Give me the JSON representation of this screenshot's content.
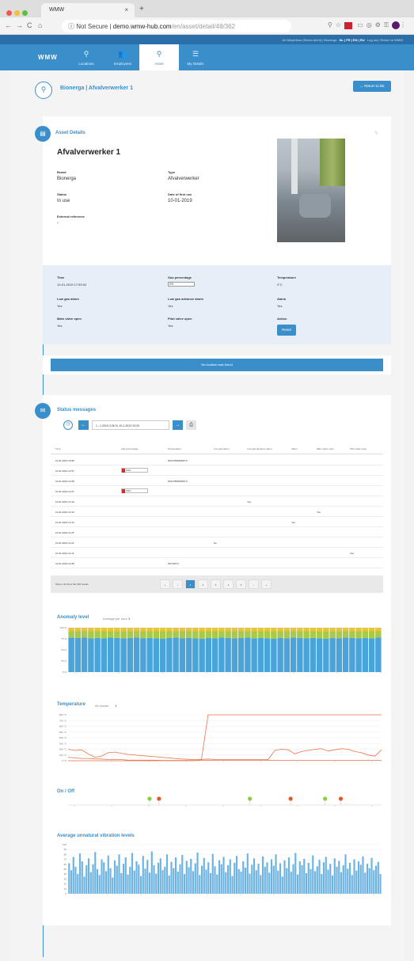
{
  "browser": {
    "tab_title": "WMW",
    "url_secure_label": "Not Secure",
    "url_host": "demo.wmw-hub.com",
    "url_path": "/en/asset/detail/48/362"
  },
  "topstrip": {
    "user": "Jef Meyenbos (Demo client)",
    "org": "Bionerga",
    "langs": "NL | FR | EN | RU",
    "links": "Log out | Return to WMW"
  },
  "nav": {
    "logo": "WMW",
    "items": [
      {
        "label": "Locations",
        "icon": "map-pin"
      },
      {
        "label": "Employees",
        "icon": "people"
      },
      {
        "label": "Asset",
        "icon": "asset-pin"
      },
      {
        "label": "My Details",
        "icon": "menu-lines"
      }
    ]
  },
  "asset_header": {
    "title": "Bionerga | Afvalverwerker 1",
    "return_button": "← Return to list"
  },
  "details": {
    "section_title": "Asset Details",
    "name": "Afvalverwerker 1",
    "fields": [
      {
        "label": "Brand",
        "value": "Bionerga"
      },
      {
        "label": "Type",
        "value": "Afvalverwerker"
      },
      {
        "label": "Status",
        "value": "In use"
      },
      {
        "label": "Date of first use",
        "value": "10-01-2019"
      },
      {
        "label": "External reference",
        "value": "-"
      }
    ]
  },
  "sensors": {
    "time_label": "Time",
    "time_value": "10-01-2019 17:53:04",
    "gas_label": "Gas percentage",
    "gas_value": "0%",
    "temp_label": "Temperature",
    "temp_value": "0°C",
    "low_gas_label": "Low gas alarm",
    "low_gas_value": "Yes",
    "low_gas_adv_label": "Low gas advance alarm",
    "low_gas_adv_value": "Yes",
    "alarm_label": "Alarm",
    "alarm_value": "Yes",
    "main_valve_label": "Main valve open",
    "main_valve_value": "Yes",
    "pilot_valve_label": "Pilot valve open",
    "pilot_valve_value": "Yes",
    "action_label": "Action",
    "reset_button": "Reset"
  },
  "location": {
    "message": "No location was found"
  },
  "status": {
    "section_title": "Status messages",
    "date_range": "1 - 1-2019 3:36 To 10-1-2019 23:29",
    "columns": [
      "Time",
      "Gas percentage",
      "Temperature",
      "Low gas alarm",
      "Low gas advance alarm",
      "Alarm",
      "Main valve open",
      "Pilot valve open"
    ],
    "rows": [
      {
        "time": "10-01-2019 16:58",
        "gas": "",
        "gas_pct": null,
        "temp": "8162786666666°C",
        "low": "",
        "adv": "",
        "alarm": "",
        "main": "",
        "pilot": ""
      },
      {
        "time": "10-01-2019 12:57",
        "gas": "100%",
        "gas_pct": 100,
        "temp": "",
        "low": "",
        "adv": "",
        "alarm": "",
        "main": "",
        "pilot": ""
      },
      {
        "time": "10-01-2019 12:48",
        "gas": "",
        "gas_pct": null,
        "temp": "8161786666666°C",
        "low": "",
        "adv": "",
        "alarm": "",
        "main": "",
        "pilot": ""
      },
      {
        "time": "10-01-2019 12:47",
        "gas": "100%",
        "gas_pct": 100,
        "temp": "",
        "low": "",
        "adv": "",
        "alarm": "",
        "main": "",
        "pilot": ""
      },
      {
        "time": "10-01-2019 12:19",
        "gas": "",
        "gas_pct": null,
        "temp": "",
        "low": "",
        "adv": "Yes",
        "alarm": "",
        "main": "",
        "pilot": ""
      },
      {
        "time": "10-01-2019 12:16",
        "gas": "",
        "gas_pct": null,
        "temp": "",
        "low": "",
        "adv": "",
        "alarm": "",
        "main": "Yes",
        "pilot": ""
      },
      {
        "time": "10-01-2019 12:13",
        "gas": "",
        "gas_pct": null,
        "temp": "",
        "low": "",
        "adv": "",
        "alarm": "Yes",
        "main": "",
        "pilot": ""
      },
      {
        "time": "10-01-2019 11:25",
        "gas": "",
        "gas_pct": null,
        "temp": "",
        "low": "",
        "adv": "",
        "alarm": "",
        "main": "",
        "pilot": ""
      },
      {
        "time": "10-01-2019 11:22",
        "gas": "",
        "gas_pct": null,
        "temp": "",
        "low": "No",
        "adv": "",
        "alarm": "",
        "main": "",
        "pilot": ""
      },
      {
        "time": "10-01-2019 11:12",
        "gas": "",
        "gas_pct": null,
        "temp": "",
        "low": "",
        "adv": "",
        "alarm": "",
        "main": "",
        "pilot": "Yes"
      },
      {
        "time": "10-01-2019 10:38",
        "gas": "",
        "gas_pct": null,
        "temp": "816.815°C",
        "low": "",
        "adv": "",
        "alarm": "",
        "main": "",
        "pilot": ""
      }
    ],
    "footer_text": "Show 1 till 10 of the 618 results",
    "pages": [
      "«",
      "‹",
      "1",
      "2",
      "3",
      "4",
      "5",
      "›",
      "»"
    ]
  },
  "anomaly": {
    "title": "Anomaly level",
    "selector": "Average per hour",
    "selector_value": "3"
  },
  "temperature": {
    "title": "Temperature",
    "selector": "All results",
    "selector_value": "3"
  },
  "onoff": {
    "title": "On / Off"
  },
  "vibration": {
    "title": "Average unnatural vibration levels"
  },
  "chart_data": [
    {
      "type": "bar",
      "title": "Anomaly level",
      "stacked": true,
      "ylim": [
        0,
        100
      ],
      "yticks": [
        "0 %",
        "25 %",
        "50 %",
        "75 %",
        "100 %"
      ],
      "bar_count": 48,
      "series": [
        {
          "values": [
            78,
            77,
            78,
            76,
            77,
            76,
            78,
            77,
            76,
            77,
            78,
            76,
            77,
            76,
            75,
            77,
            78,
            76,
            77,
            76,
            75,
            77,
            76,
            78,
            77,
            76,
            77,
            78,
            76,
            77,
            76,
            75,
            77,
            76,
            78,
            77,
            76,
            77,
            76,
            75,
            77,
            76,
            78,
            77,
            76,
            77,
            76,
            78
          ],
          "color": "#4aa3d9"
        },
        {
          "values": [
            14,
            15,
            14,
            16,
            15,
            16,
            14,
            15,
            16,
            15,
            14,
            16,
            15,
            16,
            17,
            15,
            14,
            16,
            15,
            16,
            17,
            15,
            16,
            14,
            15,
            16,
            15,
            14,
            16,
            15,
            16,
            17,
            15,
            16,
            14,
            15,
            16,
            15,
            16,
            17,
            15,
            16,
            14,
            15,
            16,
            15,
            16,
            14
          ],
          "color": "#a8c94a"
        },
        {
          "values": [
            8,
            8,
            8,
            8,
            8,
            8,
            8,
            8,
            8,
            8,
            8,
            8,
            8,
            8,
            8,
            8,
            8,
            8,
            8,
            8,
            8,
            8,
            8,
            8,
            8,
            8,
            8,
            8,
            8,
            8,
            8,
            8,
            8,
            8,
            8,
            8,
            8,
            8,
            8,
            8,
            8,
            8,
            8,
            8,
            8,
            8,
            8,
            8
          ],
          "color": "#e9c33a"
        }
      ]
    },
    {
      "type": "line",
      "title": "Temperature",
      "ylim": [
        0,
        800
      ],
      "yticks": [
        "0 °C",
        "100 °C",
        "200 °C",
        "300 °C",
        "400 °C",
        "500 °C",
        "600 °C",
        "700 °C",
        "800 °C"
      ],
      "series": [
        {
          "color": "#e8734a",
          "values": [
            200,
            180,
            190,
            120,
            60,
            80,
            140,
            150,
            130,
            110,
            100,
            90,
            80,
            70,
            60,
            50,
            40,
            30,
            25,
            20,
            20,
            800,
            800,
            800,
            800,
            800,
            800,
            800,
            800,
            800,
            800,
            800,
            800,
            800,
            800,
            800,
            800,
            800,
            800,
            800,
            800,
            800,
            800,
            800,
            800,
            800,
            800,
            800
          ]
        },
        {
          "color": "#e8734a",
          "values": [
            60,
            50,
            40,
            40,
            30,
            30,
            20,
            20,
            20,
            10,
            10,
            10,
            10,
            10,
            5,
            5,
            5,
            5,
            5,
            5,
            5,
            5,
            5,
            5,
            5,
            5,
            5,
            5,
            5,
            5,
            5,
            5,
            5,
            5,
            5,
            5,
            5,
            5,
            5,
            5,
            5,
            5,
            5,
            5,
            5,
            5,
            5,
            5
          ]
        },
        {
          "color": "#e8734a",
          "values": [
            0,
            0,
            0,
            0,
            0,
            0,
            0,
            0,
            0,
            0,
            0,
            0,
            0,
            0,
            0,
            0,
            0,
            0,
            0,
            0,
            20,
            30,
            20,
            20,
            20,
            20,
            20,
            20,
            20,
            20,
            20,
            180,
            200,
            190,
            120,
            160,
            180,
            200,
            210,
            170,
            190,
            210,
            200,
            160,
            140,
            100,
            80,
            190
          ]
        }
      ]
    },
    {
      "type": "scatter",
      "title": "On / Off",
      "points": [
        {
          "x": 0.26,
          "state": "on"
        },
        {
          "x": 0.29,
          "state": "off"
        },
        {
          "x": 0.58,
          "state": "on"
        },
        {
          "x": 0.71,
          "state": "off"
        },
        {
          "x": 0.82,
          "state": "on"
        },
        {
          "x": 0.87,
          "state": "off"
        }
      ]
    },
    {
      "type": "bar",
      "title": "Average unnatural vibration levels",
      "ylim": [
        0,
        100
      ],
      "yticks": [
        "0",
        "10",
        "20",
        "30",
        "40",
        "50",
        "60",
        "70",
        "80",
        "90",
        "100"
      ],
      "values": [
        62,
        48,
        75,
        55,
        40,
        82,
        66,
        35,
        58,
        72,
        44,
        60,
        85,
        50,
        38,
        70,
        64,
        46,
        78,
        52,
        33,
        68,
        57,
        80,
        42,
        61,
        74,
        39,
        55,
        83,
        47,
        66,
        59,
        36,
        77,
        51,
        69,
        43,
        86,
        58,
        41,
        63,
        72,
        48,
        55,
        80,
        37,
        65,
        52,
        74,
        45,
        60,
        79,
        40,
        67,
        54,
        71,
        46,
        62,
        84,
        38,
        57,
        73,
        49,
        64,
        42,
        81,
        56,
        39,
        68,
        60,
        75,
        44,
        58,
        70,
        36,
        63,
        77,
        50,
        45,
        66,
        53,
        82,
        41,
        59,
        72,
        48,
        61,
        38,
        76,
        55,
        64,
        43,
        70,
        57,
        80,
        47,
        62,
        35,
        68,
        52,
        74,
        45,
        60,
        83,
        39,
        66,
        58,
        71,
        42,
        63,
        50,
        78,
        46,
        56,
        69,
        40,
        64,
        75,
        49,
        61,
        37,
        72,
        55,
        67,
        44,
        58,
        80,
        51,
        63,
        38,
        70,
        47,
        66,
        59,
        76,
        43,
        61,
        52,
        73,
        48,
        57,
        65,
        40
      ]
    }
  ]
}
